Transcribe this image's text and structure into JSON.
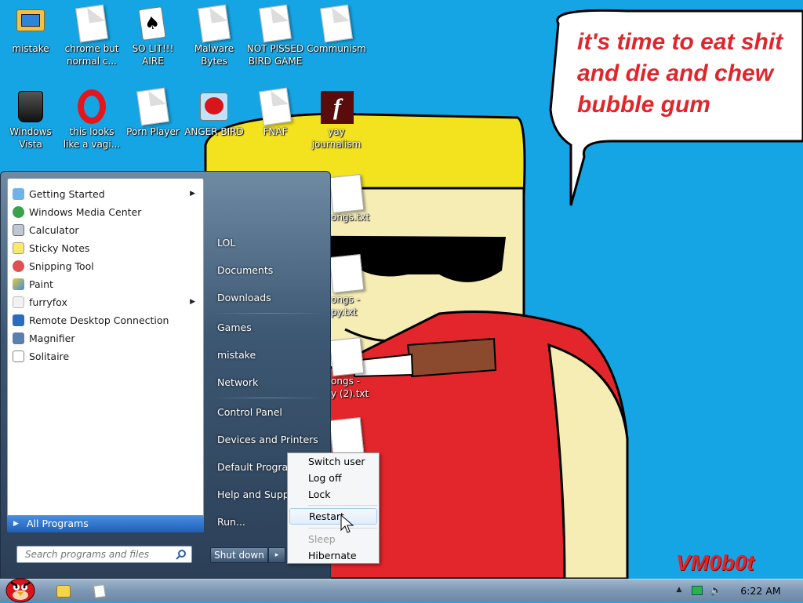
{
  "desktop_icons": [
    {
      "label": "mistake",
      "icon": "computer-folder-icon"
    },
    {
      "label": "chrome but normal c...",
      "icon": "document-icon"
    },
    {
      "label": "SO LIT!!! AIRE",
      "icon": "solitaire-icon"
    },
    {
      "label": "Malware Bytes",
      "icon": "document-icon"
    },
    {
      "label": "NOT PISSED BIRD GAME",
      "icon": "document-icon"
    },
    {
      "label": "Communism",
      "icon": "document-icon"
    },
    {
      "label": "Windows Vista",
      "icon": "trash-bin-icon"
    },
    {
      "label": "this looks like a vagi...",
      "icon": "opera-icon"
    },
    {
      "label": "Porn Player",
      "icon": "document-icon"
    },
    {
      "label": "ANGER BIRD",
      "icon": "angry-bird-icon"
    },
    {
      "label": "FNAF",
      "icon": "document-icon"
    },
    {
      "label": "yay journalism",
      "icon": "flash-icon"
    }
  ],
  "desktop_files": [
    {
      "label": "ongs.txt"
    },
    {
      "label": "ongs -"
    },
    {
      "label": "py.txt"
    },
    {
      "label": "ongs -"
    },
    {
      "label": "y (2).txt"
    }
  ],
  "wallpaper": {
    "speech": [
      "it's time to eat shit",
      "and die and chew",
      "bubble gum"
    ],
    "signature": "VM0b0t",
    "colors": {
      "sky": "#16a5e4",
      "hair": "#f3e21e",
      "skin": "#f5edb4",
      "shirt": "#e3262b",
      "cigar": "#8b4a2e",
      "text": "#e0262b"
    }
  },
  "start_menu": {
    "programs": [
      {
        "label": "Getting Started",
        "icon": "getting-started-icon",
        "has_submenu": true
      },
      {
        "label": "Windows Media Center",
        "icon": "media-center-icon",
        "has_submenu": false
      },
      {
        "label": "Calculator",
        "icon": "calculator-icon",
        "has_submenu": false
      },
      {
        "label": "Sticky Notes",
        "icon": "sticky-notes-icon",
        "has_submenu": false
      },
      {
        "label": "Snipping Tool",
        "icon": "scissors-icon",
        "has_submenu": false
      },
      {
        "label": "Paint",
        "icon": "paint-icon",
        "has_submenu": false
      },
      {
        "label": "furryfox",
        "icon": "furryfox-icon",
        "has_submenu": true
      },
      {
        "label": "Remote Desktop Connection",
        "icon": "remote-desktop-icon",
        "has_submenu": false
      },
      {
        "label": "Magnifier",
        "icon": "magnifier-icon",
        "has_submenu": false
      },
      {
        "label": "Solitaire",
        "icon": "solitaire-icon",
        "has_submenu": false
      }
    ],
    "all_programs": "All Programs",
    "search_placeholder": "Search programs and files",
    "right_items": [
      {
        "label": "LOL"
      },
      {
        "label": "Documents"
      },
      {
        "label": "Downloads"
      },
      {
        "label": "Games"
      },
      {
        "label": "mistake"
      },
      {
        "label": "Network"
      },
      {
        "label": "Control Panel"
      },
      {
        "label": "Devices and Printers"
      },
      {
        "label": "Default Programs"
      },
      {
        "label": "Help and Support"
      },
      {
        "label": "Run..."
      }
    ],
    "shutdown_label": "Shut down",
    "shutdown_arrow": "▸"
  },
  "shutdown_menu": {
    "items": [
      {
        "label": "Switch user",
        "enabled": true
      },
      {
        "label": "Log off",
        "enabled": true
      },
      {
        "label": "Lock",
        "enabled": true
      },
      {
        "label": "Restart",
        "enabled": true,
        "hovered": true
      },
      {
        "label": "Sleep",
        "enabled": false
      },
      {
        "label": "Hibernate",
        "enabled": true
      }
    ]
  },
  "taskbar": {
    "clock": "6:22 AM",
    "tray_icons": [
      "show-hidden-icon",
      "network-icon",
      "volume-icon"
    ],
    "pinned": [
      "start-orb-angry-bird",
      "folder-icon",
      "document-icon"
    ]
  }
}
